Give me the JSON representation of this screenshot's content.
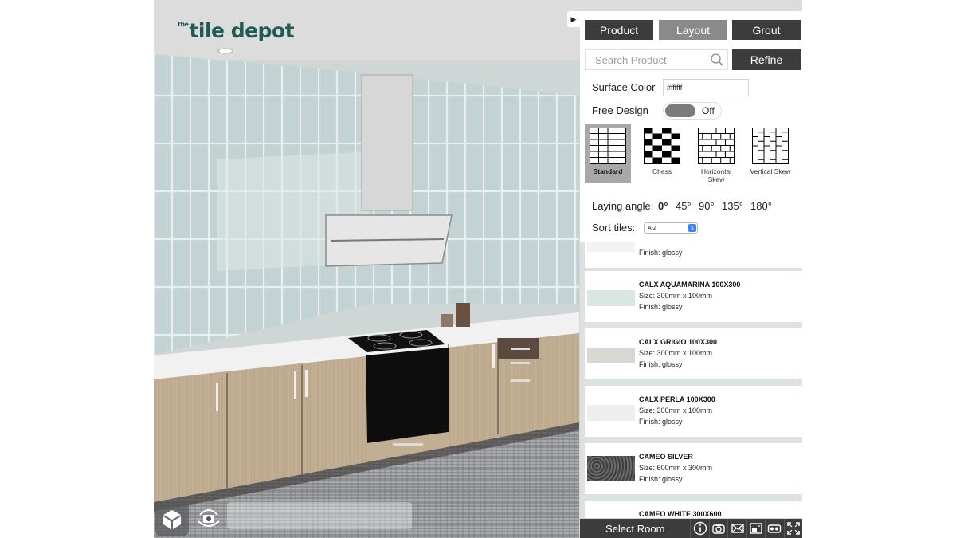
{
  "brand": {
    "the": "the",
    "name": "tile depot"
  },
  "tabs": [
    {
      "label": "Product"
    },
    {
      "label": "Layout"
    },
    {
      "label": "Grout"
    }
  ],
  "search": {
    "placeholder": "Search Product",
    "icon": "search-icon"
  },
  "refine_label": "Refine",
  "surface_color": {
    "label": "Surface Color",
    "value": "#ffffff"
  },
  "free_design": {
    "label": "Free Design",
    "state": "Off"
  },
  "patterns": [
    {
      "label": "Standard",
      "selected": true
    },
    {
      "label": "Chess",
      "selected": false
    },
    {
      "label": "Horizontal Skew",
      "selected": false
    },
    {
      "label": "Vertical Skew",
      "selected": false
    }
  ],
  "laying_angle": {
    "label": "Laying angle:",
    "options": [
      "0°",
      "45°",
      "90°",
      "135°",
      "180°"
    ],
    "selected": "0°"
  },
  "sort": {
    "label": "Sort tiles:",
    "value": "A-Z"
  },
  "products": [
    {
      "name": "",
      "size": "",
      "finish": "Finish: glossy",
      "swatch": "#f1f3f3"
    },
    {
      "name": "CALX AQUAMARINA 100X300",
      "size": "Size: 300mm x 100mm",
      "finish": "Finish: glossy",
      "swatch": "#d9e6e4"
    },
    {
      "name": "CALX GRIGIO 100X300",
      "size": "Size: 300mm x 100mm",
      "finish": "Finish: glossy",
      "swatch": "#d8d7d4"
    },
    {
      "name": "CALX PERLA 100X300",
      "size": "Size: 300mm x 100mm",
      "finish": "Finish: glossy",
      "swatch": "#eeeeec"
    },
    {
      "name": "CAMEO SILVER",
      "size": "Size: 600mm x 300mm",
      "finish": "Finish: glossy",
      "swatch": "#5a5a5a"
    },
    {
      "name": "CAMEO WHITE 300X600",
      "size": "",
      "finish": "",
      "swatch": "#ffffff"
    }
  ],
  "bottom_bar": {
    "select_room": "Select Room",
    "icons": [
      "info-icon",
      "camera-icon",
      "email-icon",
      "compare-icon",
      "vr-icon",
      "fullscreen-icon"
    ]
  },
  "colors": {
    "dark_button": "#3c3c3c",
    "active_tab": "#8a8a8a",
    "brand": "#1f5a56",
    "wall_tile": "#c3d3d3"
  }
}
